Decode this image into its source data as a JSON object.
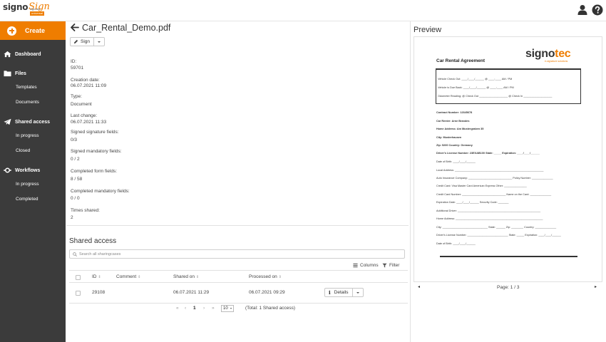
{
  "brand": {
    "name_part1": "signo",
    "name_part2": "Sign",
    "badge": "universal",
    "subtitle": "signotec"
  },
  "header": {
    "user_icon": "user-icon",
    "help_icon": "help-icon"
  },
  "sidebar": {
    "create_label": "Create",
    "sections": [
      {
        "label": "Dashboard",
        "icon": "home-icon",
        "items": []
      },
      {
        "label": "Files",
        "icon": "folder-icon",
        "items": [
          "Templates",
          "Documents"
        ]
      },
      {
        "label": "Shared access",
        "icon": "paper-plane-icon",
        "items": [
          "In progress",
          "Closed"
        ]
      },
      {
        "label": "Workflows",
        "icon": "workflow-icon",
        "items": [
          "In progress",
          "Completed"
        ]
      }
    ],
    "accent": "#ef7d00",
    "background": "#3b3b3b"
  },
  "document": {
    "title": "Car_Rental_Demo.pdf",
    "sign_label": "Sign",
    "fields": [
      {
        "label": "ID:",
        "value": "59701"
      },
      {
        "label": "Creation date:",
        "value": "06.07.2021 11:09"
      },
      {
        "label": "Type:",
        "value": "Document"
      },
      {
        "label": "Last change:",
        "value": "06.07.2021 11:33"
      },
      {
        "label": "Signed signature fields:",
        "value": "0/3"
      },
      {
        "label": "Signed mandatory fields:",
        "value": "0 / 2"
      },
      {
        "label": "Completed form fields:",
        "value": "8 / 58"
      },
      {
        "label": "Completed mandatory fields:",
        "value": "0 / 0"
      },
      {
        "label": "Times shared:",
        "value": "2"
      }
    ]
  },
  "shared_access": {
    "title": "Shared access",
    "search_placeholder": "Search all sharingcases",
    "columns_label": "Columns",
    "filter_label": "Filter",
    "headers": {
      "id": "ID",
      "comment": "Comment",
      "shared_on": "Shared on",
      "processed_on": "Processed on"
    },
    "rows": [
      {
        "id": "29108",
        "comment": "",
        "shared_on": "06.07.2021 11:29",
        "processed_on": "06.07.2021 09:29",
        "action": "Details"
      }
    ],
    "pager": {
      "first": "«",
      "prev": "‹",
      "current": "1",
      "next": "›",
      "last": "»",
      "page_size": "10",
      "total": "(Total: 1 Shared access)"
    }
  },
  "preview": {
    "title": "Preview",
    "page_indicator": "Page: 1 / 3",
    "prev_arrow": "◂",
    "next_arrow": "▸",
    "pdf": {
      "heading": "Car Rental Agreement",
      "logo_part1": "signo",
      "logo_part2": "tec",
      "logo_sub": "e-signature solutions",
      "box_lines": [
        "Vehicle Check Out: ____/____/______ @ ____:____ AM / PM",
        "Vehicle is Due Back: ____/____/______ @ ____:____ AM / PM",
        "Odometer Reading: @ Check Out ___________________ @ Check In ___________________"
      ],
      "lines": [
        "Contract Number: 12345678",
        "Car Renter: Arne Brandes",
        "Home Address: Am Mustergraben 35",
        "City: Musterhausen",
        "Zip: 5200  Country: Germany",
        "Driver's License Number: 23EXAB100  State: _____  Expiration: ____/____/______",
        "Date of Birth: ____/____/______",
        "Local Address: ___________________________________________________________",
        "Auto Insurance Company: _____________________________  Policy Number: ______________",
        "Credit Card: Visa  Master Card  American Express  Other: _______________",
        "Credit Card Number: _____________________________  Name on the Card: ______________",
        "Expiration Date: ____/____/______  Security Code: _______",
        "Additional Driver: _______________________________________________________",
        "Home Address: __________________________________________________________",
        "City: ______________________________  State: ______  Zip: ________  Country: ______________",
        "Driver's License Number: ___________________________  State: _____  Expiration: ____/____/______",
        "Date of Birth: ____/____/______"
      ]
    }
  }
}
